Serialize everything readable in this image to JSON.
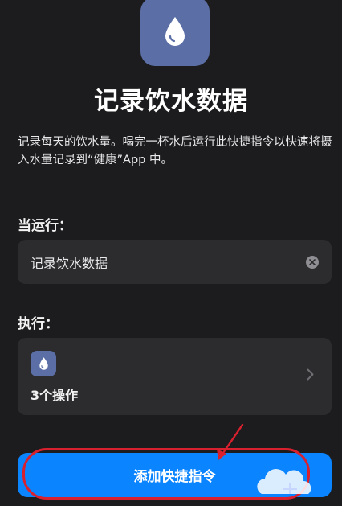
{
  "shortcut": {
    "title": "记录饮水数据",
    "description": "记录每天的饮水量。喝完一杯水后运行此快捷指令以快速将摄入水量记录到“健康”App 中。"
  },
  "when_run": {
    "label": "当运行：",
    "field_value": "记录饮水数据"
  },
  "do": {
    "label": "执行：",
    "action_count": "3个操作"
  },
  "add_button": {
    "label": "添加快捷指令"
  },
  "colors": {
    "background": "#1c1c1e",
    "card": "#2c2c2e",
    "accent": "#0a84ff",
    "icon_tile": "#5b6fa6",
    "annotation": "#d8202e"
  },
  "icons": {
    "app": "water-drop-icon",
    "clear": "clear-x-icon",
    "chevron": "chevron-right-icon"
  }
}
